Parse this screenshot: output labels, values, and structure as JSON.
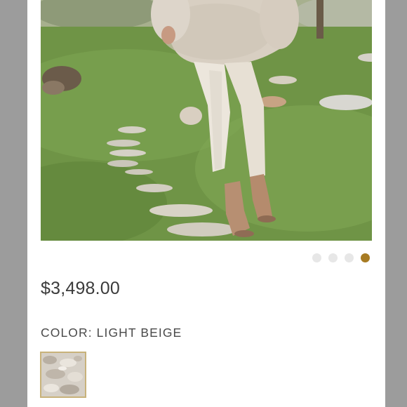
{
  "product": {
    "price": "$3,498.00",
    "color_label": "COLOR: LIGHT BEIGE",
    "selected_color": "LIGHT BEIGE"
  },
  "carousel": {
    "slide_count": 4,
    "active_index": 3,
    "accent_color": "#a77b23"
  },
  "icons": {
    "swatch": "shearling-texture-swatch"
  }
}
